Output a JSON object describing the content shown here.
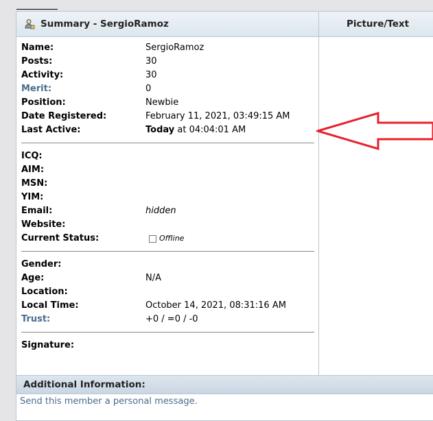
{
  "header": {
    "summary_title": "Summary - SergioRamoz",
    "picture_title": "Picture/Text",
    "icon": "user-icon"
  },
  "profile": {
    "name_label": "Name:",
    "name_value": "SergioRamoz",
    "posts_label": "Posts:",
    "posts_value": "30",
    "activity_label": "Activity:",
    "activity_value": "30",
    "merit_label": "Merit:",
    "merit_value": "0",
    "position_label": "Position:",
    "position_value": "Newbie",
    "registered_label": "Date Registered:",
    "registered_value": "February 11, 2021, 03:49:15 AM",
    "active_label": "Last Active:",
    "active_today": "Today",
    "active_time": " at 04:04:01 AM"
  },
  "contact": {
    "icq_label": "ICQ:",
    "aim_label": "AIM:",
    "msn_label": "MSN:",
    "yim_label": "YIM:",
    "email_label": "Email:",
    "email_value": "hidden",
    "website_label": "Website:",
    "status_label": "Current Status:",
    "status_value": "Offline"
  },
  "personal": {
    "gender_label": "Gender:",
    "age_label": "Age:",
    "age_value": "N/A",
    "location_label": "Location:",
    "localtime_label": "Local Time:",
    "localtime_value": "October 14, 2021, 08:31:16 AM",
    "trust_label": "Trust:",
    "trust_value": "+0 / =0 / -0"
  },
  "signature": {
    "label": "Signature:"
  },
  "additional": {
    "title": "Additional Information:",
    "pm_link": "Send this member a personal message."
  },
  "colors": {
    "link": "#476c8e",
    "arrow": "#e8202a",
    "border": "#b8c6d3"
  }
}
